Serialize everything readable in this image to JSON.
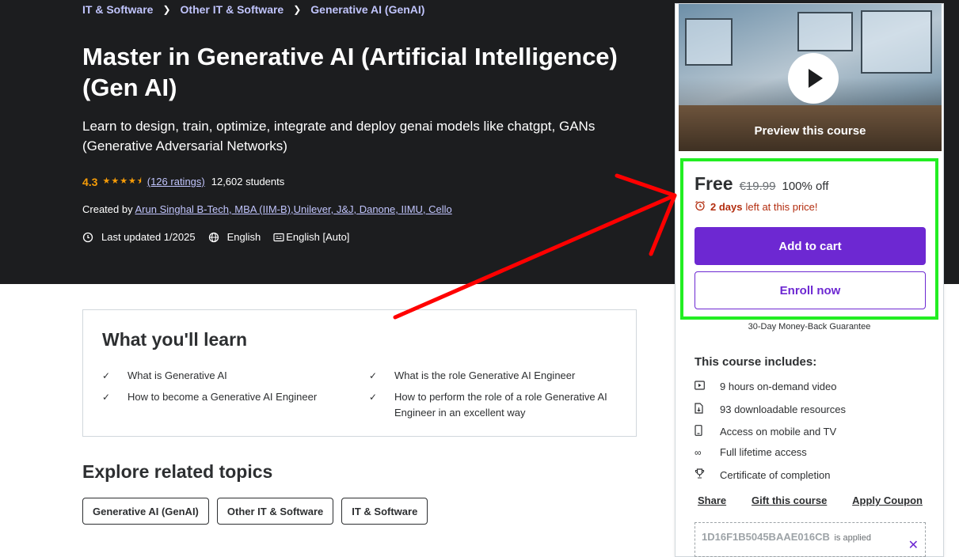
{
  "breadcrumb": [
    "IT & Software",
    "Other IT & Software",
    "Generative AI (GenAI)"
  ],
  "course": {
    "title": "Master in Generative AI (Artificial Intelligence) (Gen AI)",
    "subtitle": "Learn to design, train, optimize, integrate and deploy genai models like chatgpt, GANs (Generative Adversarial Networks)",
    "rating": "4.3",
    "ratings_count": "(126 ratings)",
    "students": "12,602 students",
    "created_by_label": "Created by",
    "author": "Arun Singhal B-Tech, MBA (IIM-B),Unilever, J&J, Danone, IIMU, Cello",
    "last_updated": "Last updated 1/2025",
    "language": "English",
    "captions": "English [Auto]"
  },
  "learn": {
    "title": "What you'll learn",
    "items": [
      "What is Generative AI",
      "What is the role Generative AI Engineer",
      "How to become a Generative AI Engineer",
      "How to perform the role of a role Generative AI Engineer in an excellent way"
    ]
  },
  "related": {
    "title": "Explore related topics",
    "tags": [
      "Generative AI (GenAI)",
      "Other IT & Software",
      "IT & Software"
    ]
  },
  "sidebar": {
    "preview_label": "Preview this course",
    "price": "Free",
    "original_price": "€19.99",
    "discount": "100% off",
    "timer_days": "2 days",
    "timer_text": "left at this price!",
    "add_to_cart": "Add to cart",
    "enroll_now": "Enroll now",
    "guarantee": "30-Day Money-Back Guarantee",
    "includes_title": "This course includes:",
    "includes": [
      {
        "icon": "video-icon",
        "text": "9 hours on-demand video"
      },
      {
        "icon": "file-download-icon",
        "text": "93 downloadable resources"
      },
      {
        "icon": "mobile-icon",
        "text": "Access on mobile and TV"
      },
      {
        "icon": "infinity-icon",
        "text": "Full lifetime access"
      },
      {
        "icon": "trophy-icon",
        "text": "Certificate of completion"
      }
    ],
    "links": [
      "Share",
      "Gift this course",
      "Apply Coupon"
    ],
    "coupon_code": "1D16F1B5045BAAE016CB",
    "coupon_applied": "is applied"
  },
  "colors": {
    "hero_bg": "#1c1d1f",
    "accent_purple": "#6d28d2",
    "link_lavender": "#c0c4fc",
    "star_orange": "#f69c08",
    "timer_red": "#b32d0f",
    "highlight_green": "#22ee22",
    "annotation_red": "#ff0000"
  }
}
